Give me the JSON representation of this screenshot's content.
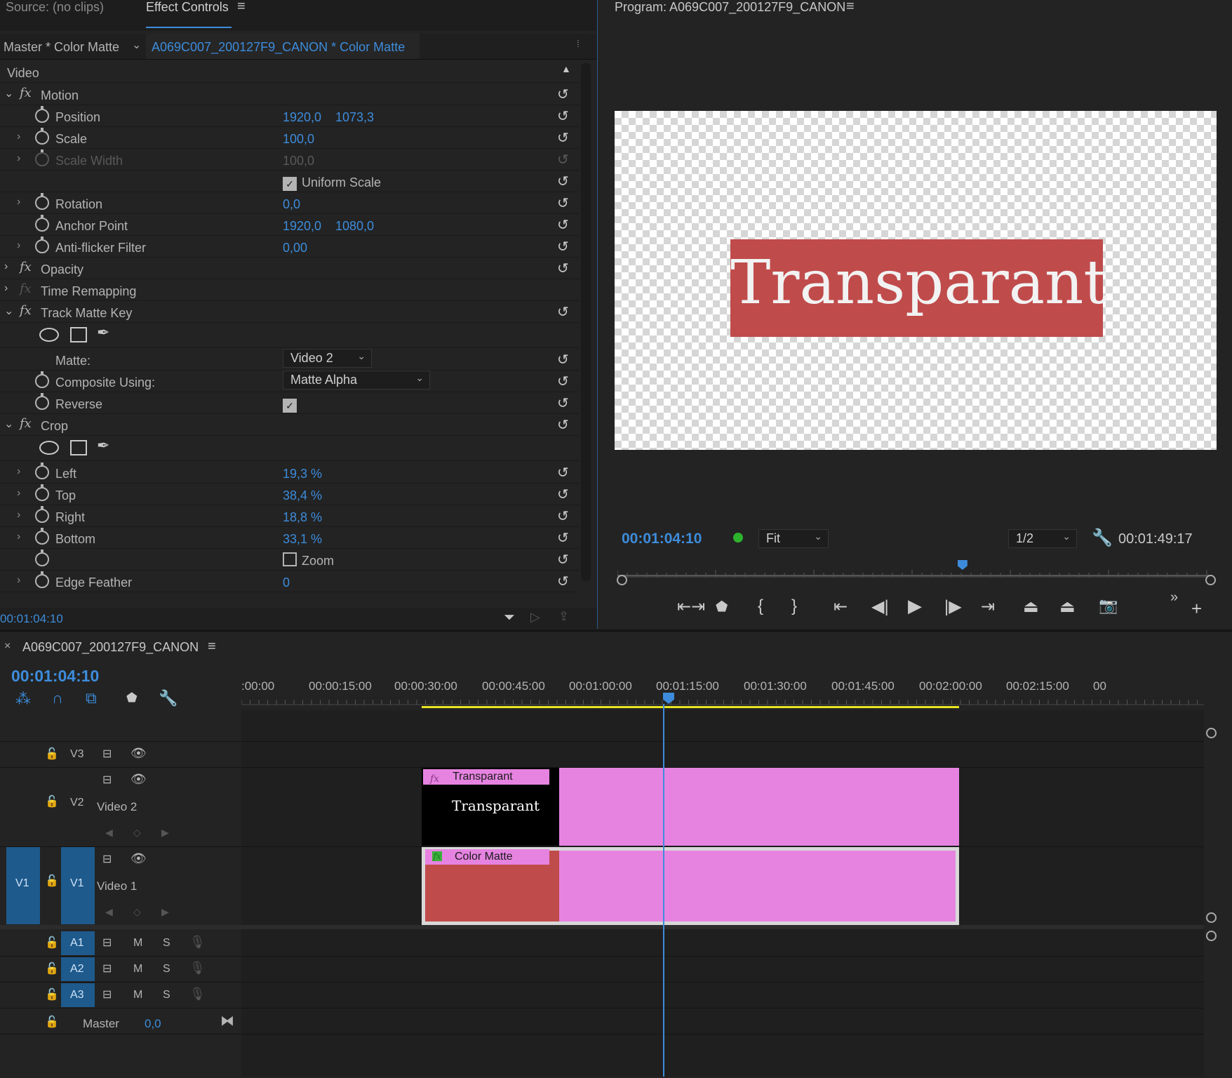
{
  "source_panel": {
    "tab_source": "Source: (no clips)",
    "tab_effect_controls": "Effect Controls"
  },
  "effect_controls": {
    "master_label": "Master * Color Matte",
    "clip_label": "A069C007_200127F9_CANON * Color Matte",
    "section": "Video",
    "motion": {
      "title": "Motion",
      "position": {
        "label": "Position",
        "x": "1920,0",
        "y": "1073,3"
      },
      "scale": {
        "label": "Scale",
        "value": "100,0"
      },
      "scale_width": {
        "label": "Scale Width",
        "value": "100,0"
      },
      "uniform_scale": {
        "label": "Uniform Scale",
        "checked": true
      },
      "rotation": {
        "label": "Rotation",
        "value": "0,0"
      },
      "anchor_point": {
        "label": "Anchor Point",
        "x": "1920,0",
        "y": "1080,0"
      },
      "anti_flicker": {
        "label": "Anti-flicker Filter",
        "value": "0,00"
      }
    },
    "opacity": {
      "title": "Opacity"
    },
    "time_remapping": {
      "title": "Time Remapping"
    },
    "track_matte_key": {
      "title": "Track Matte Key",
      "matte": {
        "label": "Matte:",
        "value": "Video 2"
      },
      "composite_using": {
        "label": "Composite Using:",
        "value": "Matte Alpha"
      },
      "reverse": {
        "label": "Reverse",
        "checked": true
      }
    },
    "crop": {
      "title": "Crop",
      "left": {
        "label": "Left",
        "value": "19,3",
        "unit": "%"
      },
      "top": {
        "label": "Top",
        "value": "38,4",
        "unit": "%"
      },
      "right": {
        "label": "Right",
        "value": "18,8",
        "unit": "%"
      },
      "bottom": {
        "label": "Bottom",
        "value": "33,1",
        "unit": "%"
      },
      "zoom": {
        "label": "Zoom",
        "checked": false
      },
      "edge_feather": {
        "label": "Edge Feather",
        "value": "0"
      }
    },
    "timecode": "00:01:04:10"
  },
  "program": {
    "title": "Program: A069C007_200127F9_CANON",
    "preview_text": "Transparant",
    "timecode": "00:01:04:10",
    "fit": "Fit",
    "resolution": "1/2",
    "duration": "00:01:49:17",
    "playhead_fraction": 0.58
  },
  "timeline": {
    "sequence_name": "A069C007_200127F9_CANON",
    "timecode": "00:01:04:10",
    "ruler": [
      ":00:00",
      "00:00:15:00",
      "00:00:30:00",
      "00:00:45:00",
      "00:01:00:00",
      "00:01:15:00",
      "00:01:30:00",
      "00:01:45:00",
      "00:02:00:00",
      "00:02:15:00",
      "00"
    ],
    "tracks": {
      "v3": "V3",
      "v2": "V2",
      "v2_name": "Video 2",
      "v1": "V1",
      "v1_src": "V1",
      "v1_name": "Video 1",
      "a1": "A1",
      "a2": "A2",
      "a3": "A3",
      "m": "M",
      "s": "S"
    },
    "master": {
      "label": "Master",
      "value": "0,0"
    },
    "clips": {
      "v2_label": "Transparant",
      "v2_thumb_text": "Transparant",
      "v1_label": "Color Matte"
    }
  },
  "colors": {
    "accent": "#3d8cdb",
    "clip_pink": "#e683e1",
    "matte_red": "#c04b4b",
    "work_area": "#e6e61f"
  }
}
